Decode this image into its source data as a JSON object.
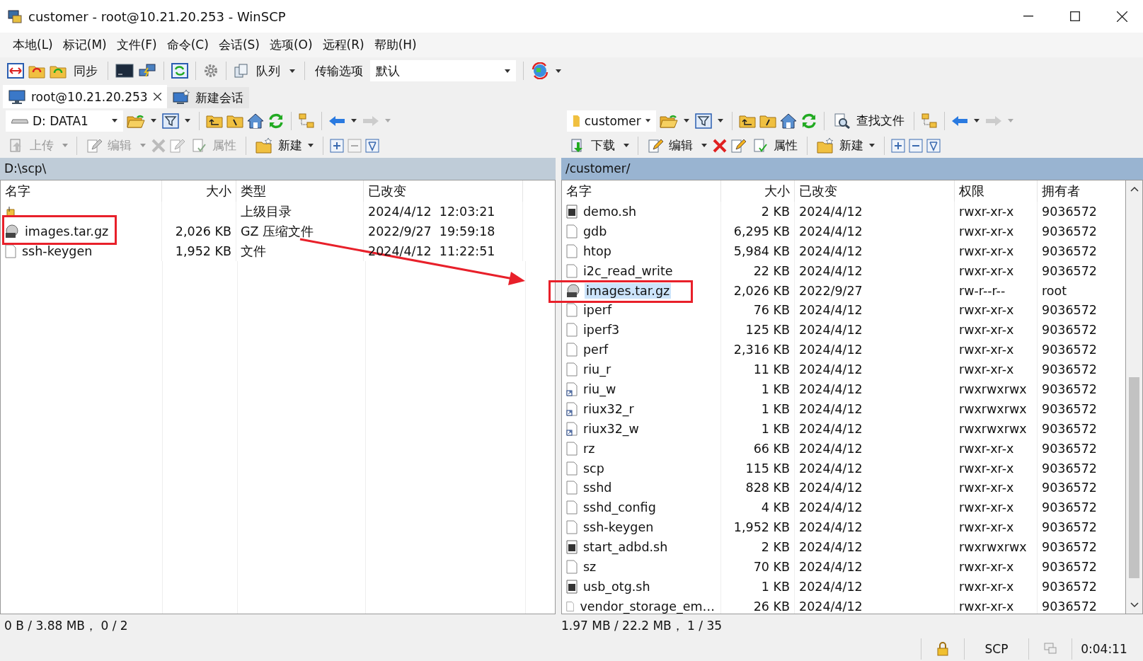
{
  "window": {
    "title": "customer - root@10.21.20.253 - WinSCP"
  },
  "menu": [
    "本地(L)",
    "标记(M)",
    "文件(F)",
    "命令(C)",
    "会话(S)",
    "选项(O)",
    "远程(R)",
    "帮助(H)"
  ],
  "toolbar": {
    "sync": "同步",
    "queue": "队列",
    "transfer_label": "传输选项",
    "transfer_value": "默认"
  },
  "tabs": [
    {
      "label": "root@10.21.20.253",
      "selected": true,
      "kind": "session"
    },
    {
      "label": "新建会话",
      "selected": false,
      "kind": "new"
    }
  ],
  "left": {
    "location": "D: DATA1",
    "path": "D:\\scp\\",
    "actions": [
      {
        "label": "上传",
        "disabled": true
      },
      {
        "label": "编辑",
        "disabled": true
      },
      {
        "label": "属性",
        "disabled": true
      },
      {
        "label": "新建",
        "disabled": false
      }
    ],
    "columns": [
      "名字",
      "大小",
      "类型",
      "已改变"
    ],
    "rows": [
      {
        "kind": "parent",
        "type": "上级目录",
        "modified": "2024/4/12  12:03:21",
        "selected": false
      },
      {
        "kind": "archive",
        "name": "images.tar.gz",
        "size": "2,026 KB",
        "type": "GZ 压缩文件",
        "modified": "2022/9/27  19:59:18",
        "selected": false
      },
      {
        "kind": "file",
        "name": "ssh-keygen",
        "size": "1,952 KB",
        "type": "文件",
        "modified": "2024/4/12  11:22:51",
        "selected": false
      }
    ],
    "status": "0 B / 3.88 MB， 0 / 2"
  },
  "right": {
    "location": "customer",
    "find": "查找文件",
    "path": "/customer/",
    "actions": [
      {
        "label": "下载",
        "disabled": false
      },
      {
        "label": "编辑",
        "disabled": false
      },
      {
        "label": "属性",
        "disabled": false
      },
      {
        "label": "新建",
        "disabled": false
      }
    ],
    "columns": [
      "名字",
      "大小",
      "已改变",
      "权限",
      "拥有者"
    ],
    "rows": [
      {
        "kind": "script",
        "name": "demo.sh",
        "size": "2 KB",
        "modified": "2024/4/12",
        "rights": "rwxr-xr-x",
        "owner": "9036572",
        "selected": false
      },
      {
        "kind": "file",
        "name": "gdb",
        "size": "6,295 KB",
        "modified": "2024/4/12",
        "rights": "rwxr-xr-x",
        "owner": "9036572",
        "selected": false
      },
      {
        "kind": "file",
        "name": "htop",
        "size": "5,984 KB",
        "modified": "2024/4/12",
        "rights": "rwxr-xr-x",
        "owner": "9036572",
        "selected": false
      },
      {
        "kind": "file",
        "name": "i2c_read_write",
        "size": "22 KB",
        "modified": "2024/4/12",
        "rights": "rwxr-xr-x",
        "owner": "9036572",
        "selected": false
      },
      {
        "kind": "archive",
        "name": "images.tar.gz",
        "size": "2,026 KB",
        "modified": "2022/9/27",
        "rights": "rw-r--r--",
        "owner": "root",
        "selected": true
      },
      {
        "kind": "file",
        "name": "iperf",
        "size": "76 KB",
        "modified": "2024/4/12",
        "rights": "rwxr-xr-x",
        "owner": "9036572",
        "selected": false
      },
      {
        "kind": "file",
        "name": "iperf3",
        "size": "125 KB",
        "modified": "2024/4/12",
        "rights": "rwxr-xr-x",
        "owner": "9036572",
        "selected": false
      },
      {
        "kind": "file",
        "name": "perf",
        "size": "2,316 KB",
        "modified": "2024/4/12",
        "rights": "rwxr-xr-x",
        "owner": "9036572",
        "selected": false
      },
      {
        "kind": "file",
        "name": "riu_r",
        "size": "11 KB",
        "modified": "2024/4/12",
        "rights": "rwxr-xr-x",
        "owner": "9036572",
        "selected": false
      },
      {
        "kind": "link",
        "name": "riu_w",
        "size": "1 KB",
        "modified": "2024/4/12",
        "rights": "rwxrwxrwx",
        "owner": "9036572",
        "selected": false
      },
      {
        "kind": "link",
        "name": "riux32_r",
        "size": "1 KB",
        "modified": "2024/4/12",
        "rights": "rwxrwxrwx",
        "owner": "9036572",
        "selected": false
      },
      {
        "kind": "link",
        "name": "riux32_w",
        "size": "1 KB",
        "modified": "2024/4/12",
        "rights": "rwxrwxrwx",
        "owner": "9036572",
        "selected": false
      },
      {
        "kind": "file",
        "name": "rz",
        "size": "66 KB",
        "modified": "2024/4/12",
        "rights": "rwxr-xr-x",
        "owner": "9036572",
        "selected": false
      },
      {
        "kind": "file",
        "name": "scp",
        "size": "115 KB",
        "modified": "2024/4/12",
        "rights": "rwxr-xr-x",
        "owner": "9036572",
        "selected": false
      },
      {
        "kind": "file",
        "name": "sshd",
        "size": "828 KB",
        "modified": "2024/4/12",
        "rights": "rwxr-xr-x",
        "owner": "9036572",
        "selected": false
      },
      {
        "kind": "file",
        "name": "sshd_config",
        "size": "4 KB",
        "modified": "2024/4/12",
        "rights": "rwxr-xr-x",
        "owner": "9036572",
        "selected": false
      },
      {
        "kind": "file",
        "name": "ssh-keygen",
        "size": "1,952 KB",
        "modified": "2024/4/12",
        "rights": "rwxr-xr-x",
        "owner": "9036572",
        "selected": false
      },
      {
        "kind": "script",
        "name": "start_adbd.sh",
        "size": "2 KB",
        "modified": "2024/4/12",
        "rights": "rwxrwxrwx",
        "owner": "9036572",
        "selected": false
      },
      {
        "kind": "file",
        "name": "sz",
        "size": "70 KB",
        "modified": "2024/4/12",
        "rights": "rwxr-xr-x",
        "owner": "9036572",
        "selected": false
      },
      {
        "kind": "script",
        "name": "usb_otg.sh",
        "size": "1 KB",
        "modified": "2024/4/12",
        "rights": "rwxr-xr-x",
        "owner": "9036572",
        "selected": false
      },
      {
        "kind": "file",
        "name": "vendor_storage_em…",
        "size": "26 KB",
        "modified": "2024/4/12",
        "rights": "rwxr-xr-x",
        "owner": "9036572",
        "selected": false
      }
    ],
    "status": "1.97 MB / 22.2 MB， 1 / 35"
  },
  "status_bar": {
    "protocol": "SCP",
    "time": "0:04:11"
  }
}
